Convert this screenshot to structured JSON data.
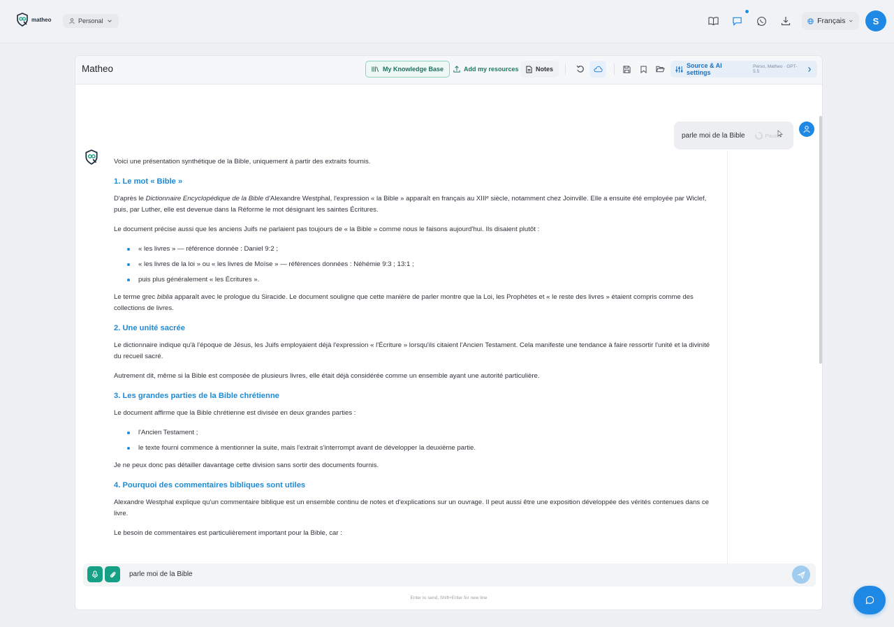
{
  "topbar": {
    "logo_text": "matheo",
    "workspace_label": "Personal",
    "language_label": "Français",
    "avatar_initial": "S"
  },
  "header": {
    "title": "Matheo",
    "knowledge_base_label": "My Knowledge Base",
    "add_resources_label": "Add my resources",
    "notes_label": "Notes",
    "settings_label": "Source & AI settings",
    "settings_sub": "Perso, Matheo · GPT-5.5"
  },
  "chat": {
    "user_message": "parle moi de la Bible",
    "bubble_action": "Pause",
    "answer": {
      "intro": "Voici une présentation synthétique de la Bible, uniquement à partir des extraits fournis.",
      "s1_title": "1. Le mot « Bible »",
      "s1_p1_pre": "D'après le ",
      "s1_p1_em": "Dictionnaire Encyclopédique de la Bible",
      "s1_p1_post": " d'Alexandre Westphal, l'expression « la Bible » apparaît en français au XIIIᵉ siècle, notamment chez Joinville. Elle a ensuite été employée par Wiclef, puis, par Luther, elle est devenue dans la Réforme le mot désignant les saintes Écritures.",
      "s1_p2": "Le document précise aussi que les anciens Juifs ne parlaient pas toujours de « la Bible » comme nous le faisons aujourd'hui. Ils disaient plutôt :",
      "s1_list": [
        "« les livres » — référence donnée : Daniel 9:2 ;",
        "« les livres de la loi » ou « les livres de Moïse » — références données : Néhémie 9:3 ; 13:1 ;",
        "puis plus généralement « les Écritures »."
      ],
      "s1_p3_pre": "Le terme grec ",
      "s1_p3_em": "biblia",
      "s1_p3_post": " apparaît avec le prologue du Siracide. Le document souligne que cette manière de parler montre que la Loi, les Prophètes et « le reste des livres » étaient compris comme des collections de livres.",
      "s2_title": "2. Une unité sacrée",
      "s2_p1": "Le dictionnaire indique qu'à l'époque de Jésus, les Juifs employaient déjà l'expression « l'Écriture » lorsqu'ils citaient l'Ancien Testament. Cela manifeste une tendance à faire ressortir l'unité et la divinité du recueil sacré.",
      "s2_p2": "Autrement dit, même si la Bible est composée de plusieurs livres, elle était déjà considérée comme un ensemble ayant une autorité particulière.",
      "s3_title": "3. Les grandes parties de la Bible chrétienne",
      "s3_p1": "Le document affirme que la Bible chrétienne est divisée en deux grandes parties :",
      "s3_list": [
        "l'Ancien Testament ;",
        "le texte fourni commence à mentionner la suite, mais l'extrait s'interrompt avant de développer la deuxième partie."
      ],
      "s3_p2": "Je ne peux donc pas détailler davantage cette division sans sortir des documents fournis.",
      "s4_title": "4. Pourquoi des commentaires bibliques sont utiles",
      "s4_p1": "Alexandre Westphal explique qu'un commentaire biblique est un ensemble continu de notes et d'explications sur un ouvrage. Il peut aussi être une exposition développée des vérités contenues dans ce livre.",
      "s4_p2": "Le besoin de commentaires est particulièrement important pour la Bible, car :"
    }
  },
  "composer": {
    "value": "parle moi de la Bible",
    "hint": "Enter to send, Shift+Enter for new line"
  },
  "colors": {
    "accent_blue": "#1e88e5",
    "heading_blue": "#1e8ad6",
    "green": "#16a085"
  }
}
